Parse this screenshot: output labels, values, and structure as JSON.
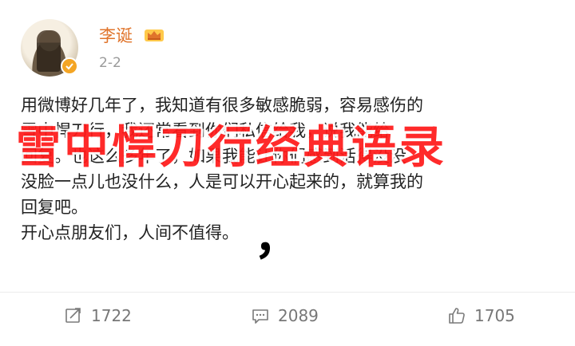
{
  "post": {
    "author": "李诞",
    "time": "2-2",
    "lines": [
      "用微博好几年了，我知道有很多敏感脆弱，容易感伤的",
      "雪中悍刀行，我还常看到你们私信给我，说我能给",
      "回复。也这么多年了，如果我能让你们感到活得没没",
      "没脸一点儿也没什么，人是可以开心起来的，就算我的",
      "回复吧。",
      "开心点朋友们，人间不值得。"
    ]
  },
  "overlay": {
    "title": "雪中悍刀行经典语录",
    "comma": "，"
  },
  "actions": {
    "repost_count": "1722",
    "comment_count": "2089",
    "like_count": "1705"
  },
  "icons": {
    "repost": "share-icon",
    "comment": "comment-icon",
    "like": "thumbs-up-icon",
    "verified": "verified-badge-icon",
    "vip": "vip-crown-icon"
  },
  "colors": {
    "username": "#e0742b",
    "watermark": "#ff1a1a",
    "verified": "#f4a524"
  }
}
